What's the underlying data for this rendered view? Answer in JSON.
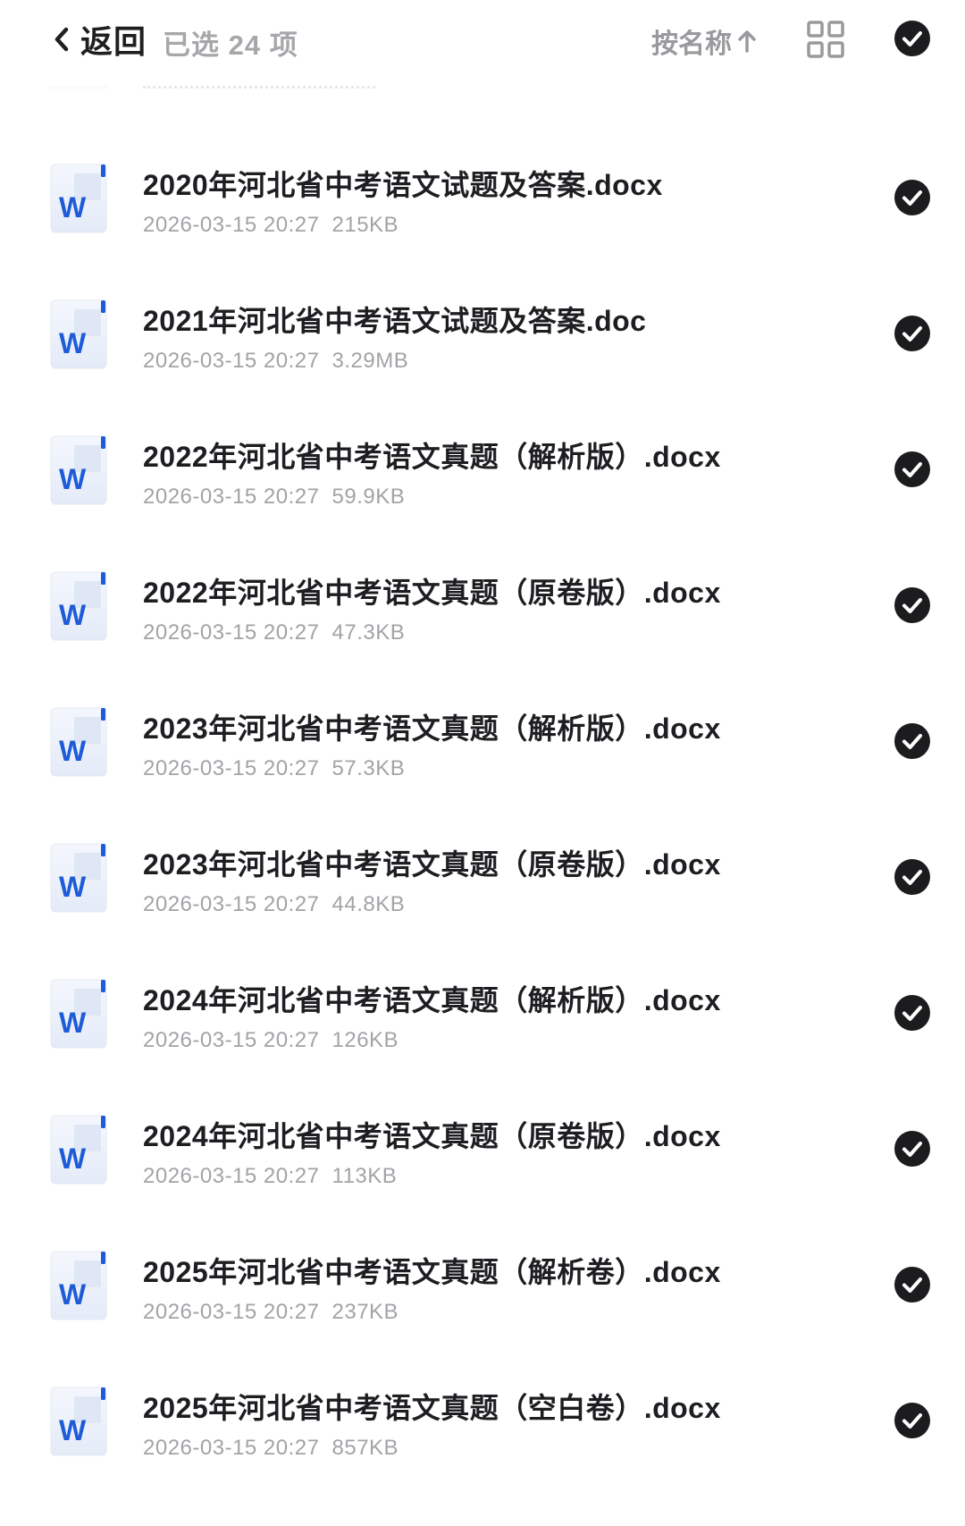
{
  "header": {
    "back_label": "返回",
    "selected_count": "已选 24 项",
    "sort_label": "按名称"
  },
  "icons": {
    "back": "chevron-left-icon",
    "sort": "arrow-up-icon",
    "view": "grid-view-icon",
    "select_all": "checkmark-circle-icon",
    "file": "word-document-icon"
  },
  "colors": {
    "check_fill": "#1c1c1e",
    "word_blue": "#1e5bd6",
    "text_primary": "#1e1e22",
    "text_secondary": "#a3a3a8"
  },
  "files": [
    {
      "name": "2020年河北省中考语文试题及答案.docx",
      "date": "2026-03-15 20:27",
      "size": "215KB",
      "selected": true
    },
    {
      "name": "2021年河北省中考语文试题及答案.doc",
      "date": "2026-03-15 20:27",
      "size": "3.29MB",
      "selected": true
    },
    {
      "name": "2022年河北省中考语文真题（解析版）.docx",
      "date": "2026-03-15 20:27",
      "size": "59.9KB",
      "selected": true
    },
    {
      "name": "2022年河北省中考语文真题（原卷版）.docx",
      "date": "2026-03-15 20:27",
      "size": "47.3KB",
      "selected": true
    },
    {
      "name": "2023年河北省中考语文真题（解析版）.docx",
      "date": "2026-03-15 20:27",
      "size": "57.3KB",
      "selected": true
    },
    {
      "name": "2023年河北省中考语文真题（原卷版）.docx",
      "date": "2026-03-15 20:27",
      "size": "44.8KB",
      "selected": true
    },
    {
      "name": "2024年河北省中考语文真题（解析版）.docx",
      "date": "2026-03-15 20:27",
      "size": "126KB",
      "selected": true
    },
    {
      "name": "2024年河北省中考语文真题（原卷版）.docx",
      "date": "2026-03-15 20:27",
      "size": "113KB",
      "selected": true
    },
    {
      "name": "2025年河北省中考语文真题（解析卷）.docx",
      "date": "2026-03-15 20:27",
      "size": "237KB",
      "selected": true
    },
    {
      "name": "2025年河北省中考语文真题（空白卷）.docx",
      "date": "2026-03-15 20:27",
      "size": "857KB",
      "selected": true
    }
  ]
}
